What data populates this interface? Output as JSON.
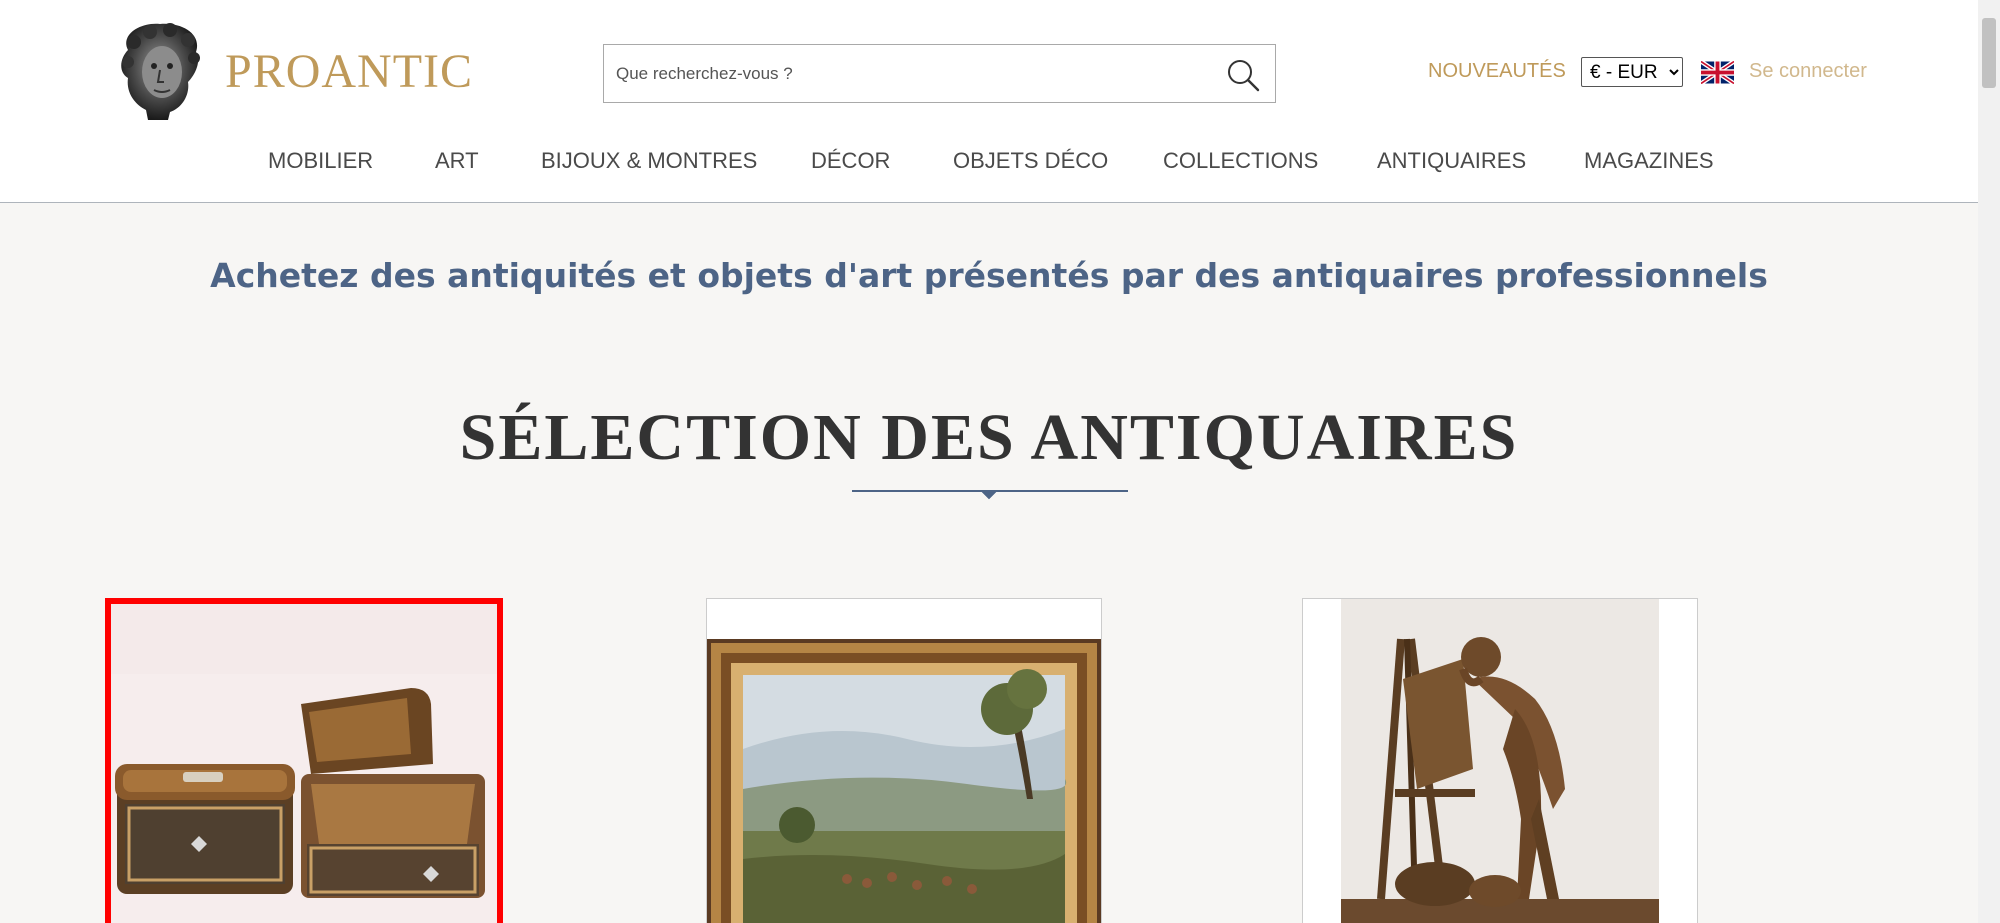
{
  "header": {
    "brand": "PROANTIC",
    "search_placeholder": "Que recherchez-vous ?",
    "nouveautes": "NOUVEAUTÉS",
    "currency_options": [
      "€ - EUR"
    ],
    "currency_selected": "€ - EUR",
    "signin": "Se connecter",
    "language_flag": "uk-flag-icon"
  },
  "nav": {
    "items": [
      {
        "label": "MOBILIER"
      },
      {
        "label": "ART"
      },
      {
        "label": "BIJOUX & MONTRES"
      },
      {
        "label": "DÉCOR"
      },
      {
        "label": "OBJETS DÉCO"
      },
      {
        "label": "COLLECTIONS"
      },
      {
        "label": "ANTIQUAIRES"
      },
      {
        "label": "MAGAZINES"
      }
    ]
  },
  "main": {
    "tagline": "Achetez des antiquités et objets d'art présentés par des antiquaires professionnels",
    "section_title": "SÉLECTION DES ANTIQUAIRES"
  },
  "colors": {
    "brand_gold": "#bf9a5a",
    "accent_blue": "#4d6486",
    "selection_red": "#ff0000",
    "page_bg": "#f7f6f4"
  }
}
